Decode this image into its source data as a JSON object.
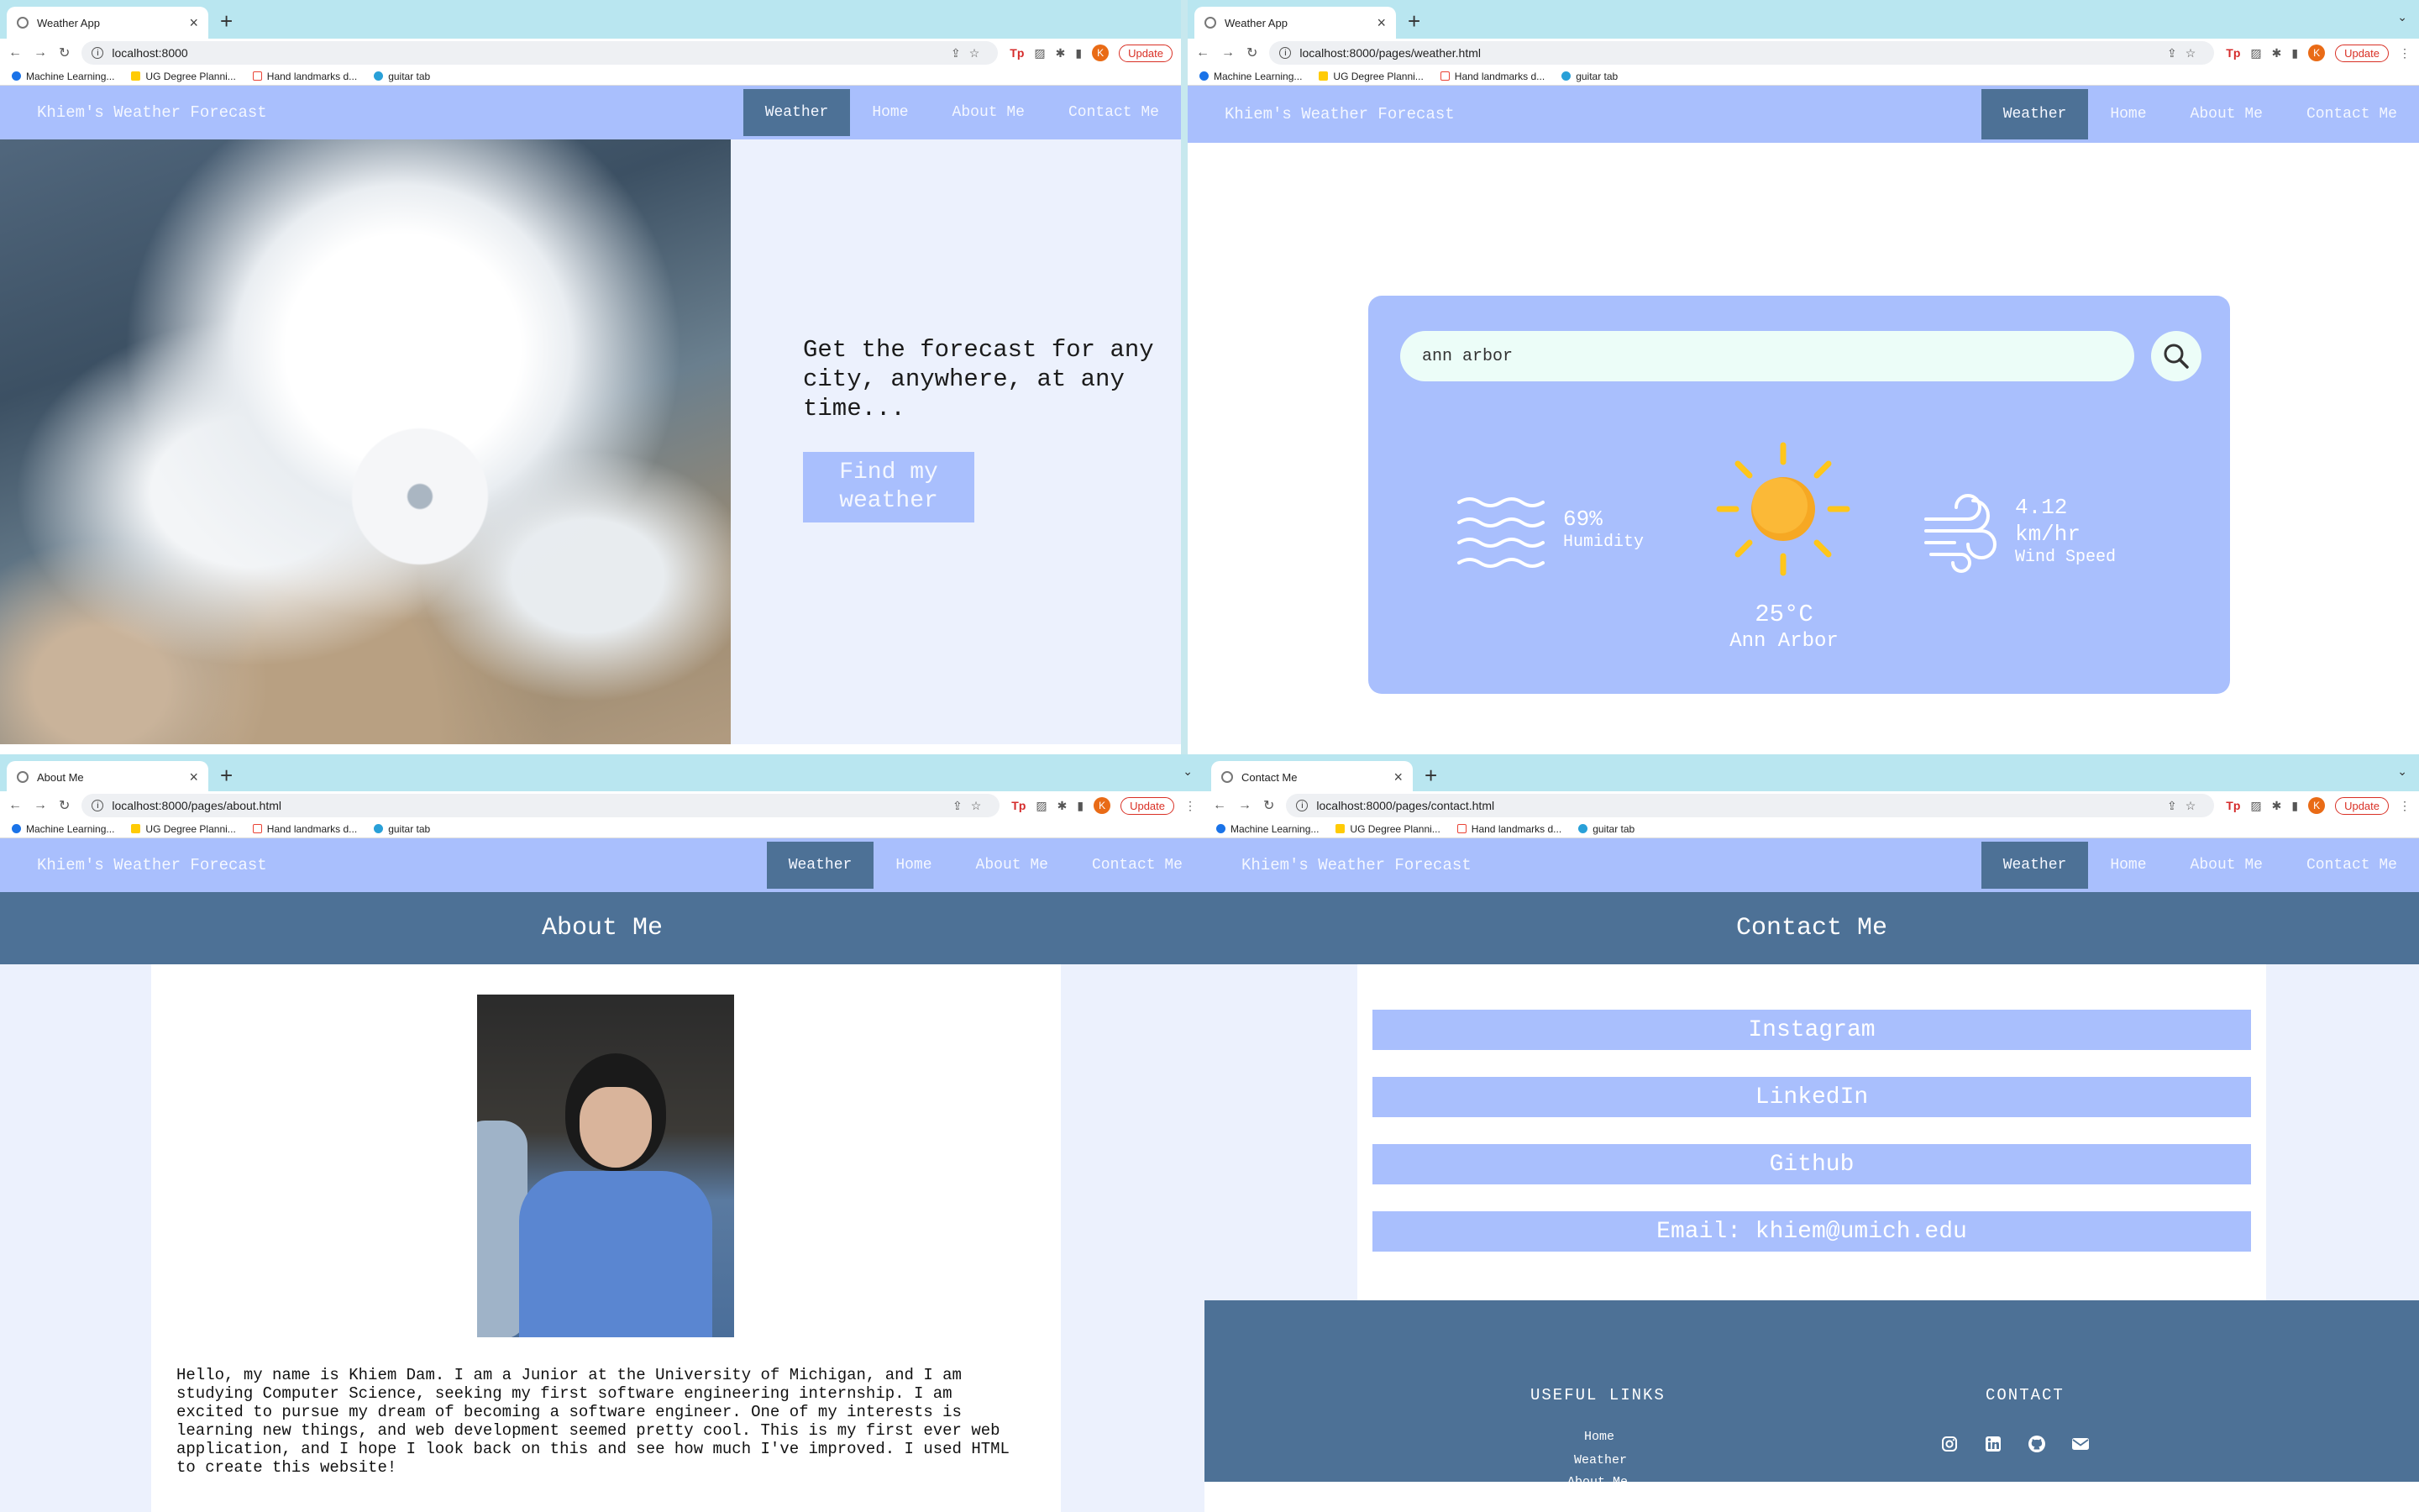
{
  "browser": {
    "tab_title_home": "Weather App",
    "tab_title_weather": "Weather App",
    "tab_title_about": "About Me",
    "tab_title_contact": "Contact Me",
    "url_home": "localhost:8000",
    "url_weather": "localhost:8000/pages/weather.html",
    "url_about": "localhost:8000/pages/about.html",
    "url_contact": "localhost:8000/pages/contact.html",
    "update_label": "Update",
    "profile_initial": "K",
    "bookmarks": [
      "Machine Learning...",
      "UG Degree Planni...",
      "Hand landmarks d...",
      "guitar tab"
    ]
  },
  "site": {
    "brand": "Khiem's Weather Forecast",
    "nav": [
      "Weather",
      "Home",
      "About Me",
      "Contact Me"
    ]
  },
  "home": {
    "headline": "Get the forecast for any city, anywhere, at any time...",
    "cta": "Find my weather"
  },
  "weather": {
    "search_value": "ann arbor",
    "humidity_value": "69%",
    "humidity_label": "Humidity",
    "temperature": "25°C",
    "city": "Ann Arbor",
    "wind_value": "4.12",
    "wind_unit": "km/hr",
    "wind_label": "Wind Speed"
  },
  "about": {
    "title": "About Me",
    "bio": "Hello, my name is Khiem Dam. I am a Junior at the University of Michigan, and I am studying Computer Science, seeking my first software engineering internship. I am excited to pursue my dream of becoming a software engineer. One of my interests is learning new things, and web development seemed pretty cool. This is my first ever web application, and I hope I look back on this and see how much I've improved. I used HTML to create this website!"
  },
  "contact": {
    "title": "Contact Me",
    "links": [
      "Instagram",
      "LinkedIn",
      "Github",
      "Email: khiem@umich.edu"
    ],
    "footer_useful": "USEFUL LINKS",
    "footer_links": [
      "Home",
      "Weather",
      "About Me"
    ],
    "footer_contact": "CONTACT"
  },
  "colors": {
    "nav_bg": "#a9bffd",
    "nav_active": "#4d7196",
    "page_bg": "#ecf1fd",
    "search_bg": "#ecfdf8",
    "sun": "#f6a823"
  }
}
